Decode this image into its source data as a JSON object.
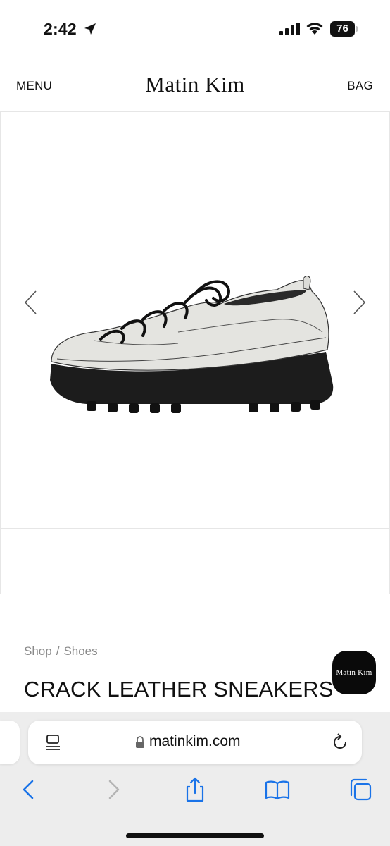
{
  "status_bar": {
    "time": "2:42",
    "battery_level": "76"
  },
  "header": {
    "menu_label": "MENU",
    "brand": "Matin Kim",
    "bag_label": "BAG"
  },
  "gallery": {
    "prev_icon": "chevron-left-icon",
    "next_icon": "chevron-right-icon"
  },
  "product": {
    "breadcrumb": [
      "Shop",
      "Shoes"
    ],
    "breadcrumb_separator": "/",
    "title": "CRACK LEATHER SNEAKERS"
  },
  "floating_badge": {
    "label": "Matin  Kim"
  },
  "safari": {
    "url": "matinkim.com"
  },
  "colors": {
    "accent_blue": "#1a73e8",
    "chrome_bg": "#ededed"
  }
}
